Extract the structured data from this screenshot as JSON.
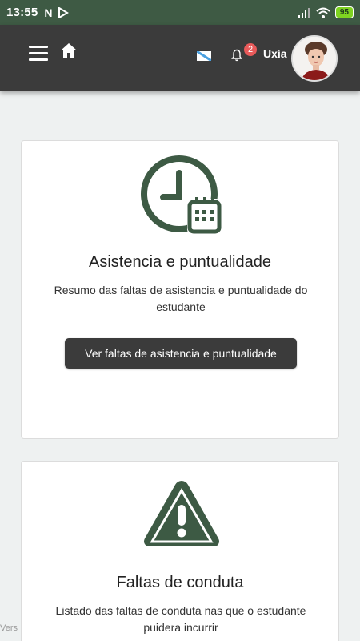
{
  "status_bar": {
    "time": "13:55",
    "app_icon": "N",
    "battery": "95"
  },
  "header": {
    "username": "Uxía",
    "notifications_count": "2"
  },
  "cards": [
    {
      "title": "Asistencia e puntualidade",
      "description": "Resumo das faltas de asistencia e puntualidade do estudante",
      "button": "Ver faltas de asistencia e puntualidade"
    },
    {
      "title": "Faltas de conduta",
      "description": "Listado das faltas de conduta nas que o estudante puidera incurrir"
    }
  ],
  "footer": {
    "version": "Vers"
  },
  "colors": {
    "status_bar": "#3e5a44",
    "app_bar": "#3b3b3b",
    "icon_green": "#3d5a44",
    "badge": "#e85a5a",
    "background": "#eef1f1"
  },
  "icons": [
    "menu-icon",
    "home-icon",
    "flag-icon",
    "bell-icon",
    "clock-calendar-icon",
    "warning-icon"
  ]
}
